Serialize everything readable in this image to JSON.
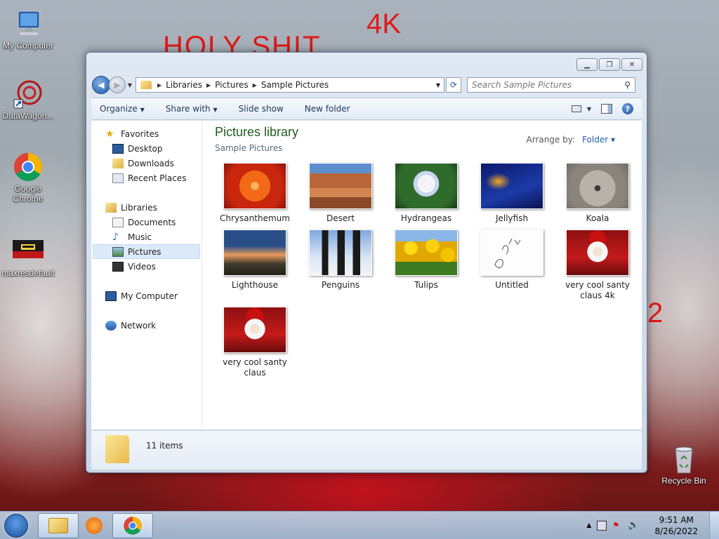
{
  "desktop": {
    "icons": [
      {
        "label": "My Computer"
      },
      {
        "label": "DataWagon..."
      },
      {
        "label": "Google Chrome"
      },
      {
        "label": "maxresdefault"
      },
      {
        "label": "Recycle Bin"
      }
    ],
    "scrawl": {
      "text1": "HOLY SHIT",
      "text2": "4K",
      "text3": "2"
    }
  },
  "window": {
    "address": {
      "crumbs": [
        "Libraries",
        "Pictures",
        "Sample Pictures"
      ]
    },
    "search": {
      "placeholder": "Search Sample Pictures"
    },
    "toolbar": {
      "organize": "Organize",
      "share_with": "Share with",
      "slide_show": "Slide show",
      "new_folder": "New folder"
    },
    "nav": {
      "favorites": "Favorites",
      "desktop": "Desktop",
      "downloads": "Downloads",
      "recent_places": "Recent Places",
      "libraries": "Libraries",
      "documents": "Documents",
      "music": "Music",
      "pictures": "Pictures",
      "videos": "Videos",
      "my_computer": "My Computer",
      "network": "Network"
    },
    "library": {
      "title": "Pictures library",
      "subtitle": "Sample Pictures",
      "arrange_label": "Arrange by:",
      "arrange_value": "Folder ▾"
    },
    "items": [
      {
        "name": "Chrysanthemum"
      },
      {
        "name": "Desert"
      },
      {
        "name": "Hydrangeas"
      },
      {
        "name": "Jellyfish"
      },
      {
        "name": "Koala"
      },
      {
        "name": "Lighthouse"
      },
      {
        "name": "Penguins"
      },
      {
        "name": "Tulips"
      },
      {
        "name": "Untitled"
      },
      {
        "name": "very cool santy claus 4k"
      },
      {
        "name": "very cool santy claus"
      }
    ],
    "details": {
      "count": "11 items"
    }
  },
  "taskbar": {
    "clock_time": "9:51 AM",
    "clock_date": "8/26/2022"
  },
  "colors": {
    "accent": "#1f5ea8",
    "library_title": "#1e5c1e"
  }
}
